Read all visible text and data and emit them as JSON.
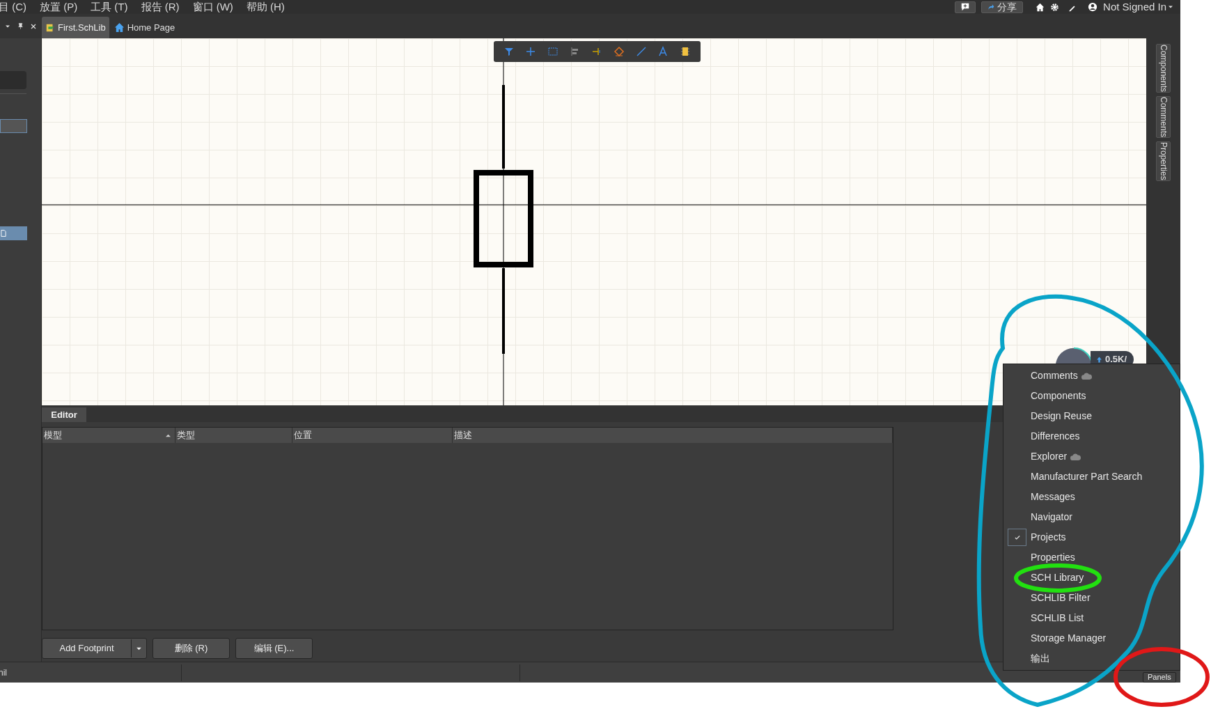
{
  "menu_bar": {
    "items": [
      "目 (C)",
      "放置 (P)",
      "工具 (T)",
      "报告 (R)",
      "窗口 (W)",
      "帮助 (H)"
    ]
  },
  "top_right": {
    "share": "分享",
    "user": "Not Signed In"
  },
  "document_tabs": [
    {
      "label": "First.SchLib",
      "kind": "schlib",
      "selected": true
    },
    {
      "label": "Home Page",
      "kind": "home",
      "selected": false
    }
  ],
  "right_tabs": [
    "Components",
    "Comments",
    "Properties"
  ],
  "bottom_panel": {
    "tab": "Editor",
    "columns": [
      {
        "label": "模型",
        "sorted": true
      },
      {
        "label": "类型",
        "sorted": false
      },
      {
        "label": "位置",
        "sorted": false
      },
      {
        "label": "描述",
        "sorted": false
      }
    ],
    "buttons": [
      {
        "label": "Add Footprint",
        "kind": "split"
      },
      {
        "label": "删除 (R)",
        "kind": "plain"
      },
      {
        "label": "编辑 (E)...",
        "kind": "plain"
      }
    ]
  },
  "speed_widget": {
    "reading": "0.5K/"
  },
  "panels_menu": [
    {
      "label": "Comments",
      "checked": false,
      "cloud": true
    },
    {
      "label": "Components",
      "checked": false,
      "cloud": false
    },
    {
      "label": "Design Reuse",
      "checked": false,
      "cloud": false
    },
    {
      "label": "Differences",
      "checked": false,
      "cloud": false
    },
    {
      "label": "Explorer",
      "checked": false,
      "cloud": true
    },
    {
      "label": "Manufacturer Part Search",
      "checked": false,
      "cloud": false
    },
    {
      "label": "Messages",
      "checked": false,
      "cloud": false
    },
    {
      "label": "Navigator",
      "checked": false,
      "cloud": false
    },
    {
      "label": "Projects",
      "checked": true,
      "cloud": false
    },
    {
      "label": "Properties",
      "checked": false,
      "cloud": false
    },
    {
      "label": "SCH Library",
      "checked": false,
      "cloud": false
    },
    {
      "label": "SCHLIB Filter",
      "checked": false,
      "cloud": false
    },
    {
      "label": "SCHLIB List",
      "checked": false,
      "cloud": false
    },
    {
      "label": "Storage Manager",
      "checked": false,
      "cloud": false
    },
    {
      "label": "输出",
      "checked": false,
      "cloud": false
    }
  ],
  "status_bar": {
    "units": "nil",
    "panels_button": "Panels"
  }
}
